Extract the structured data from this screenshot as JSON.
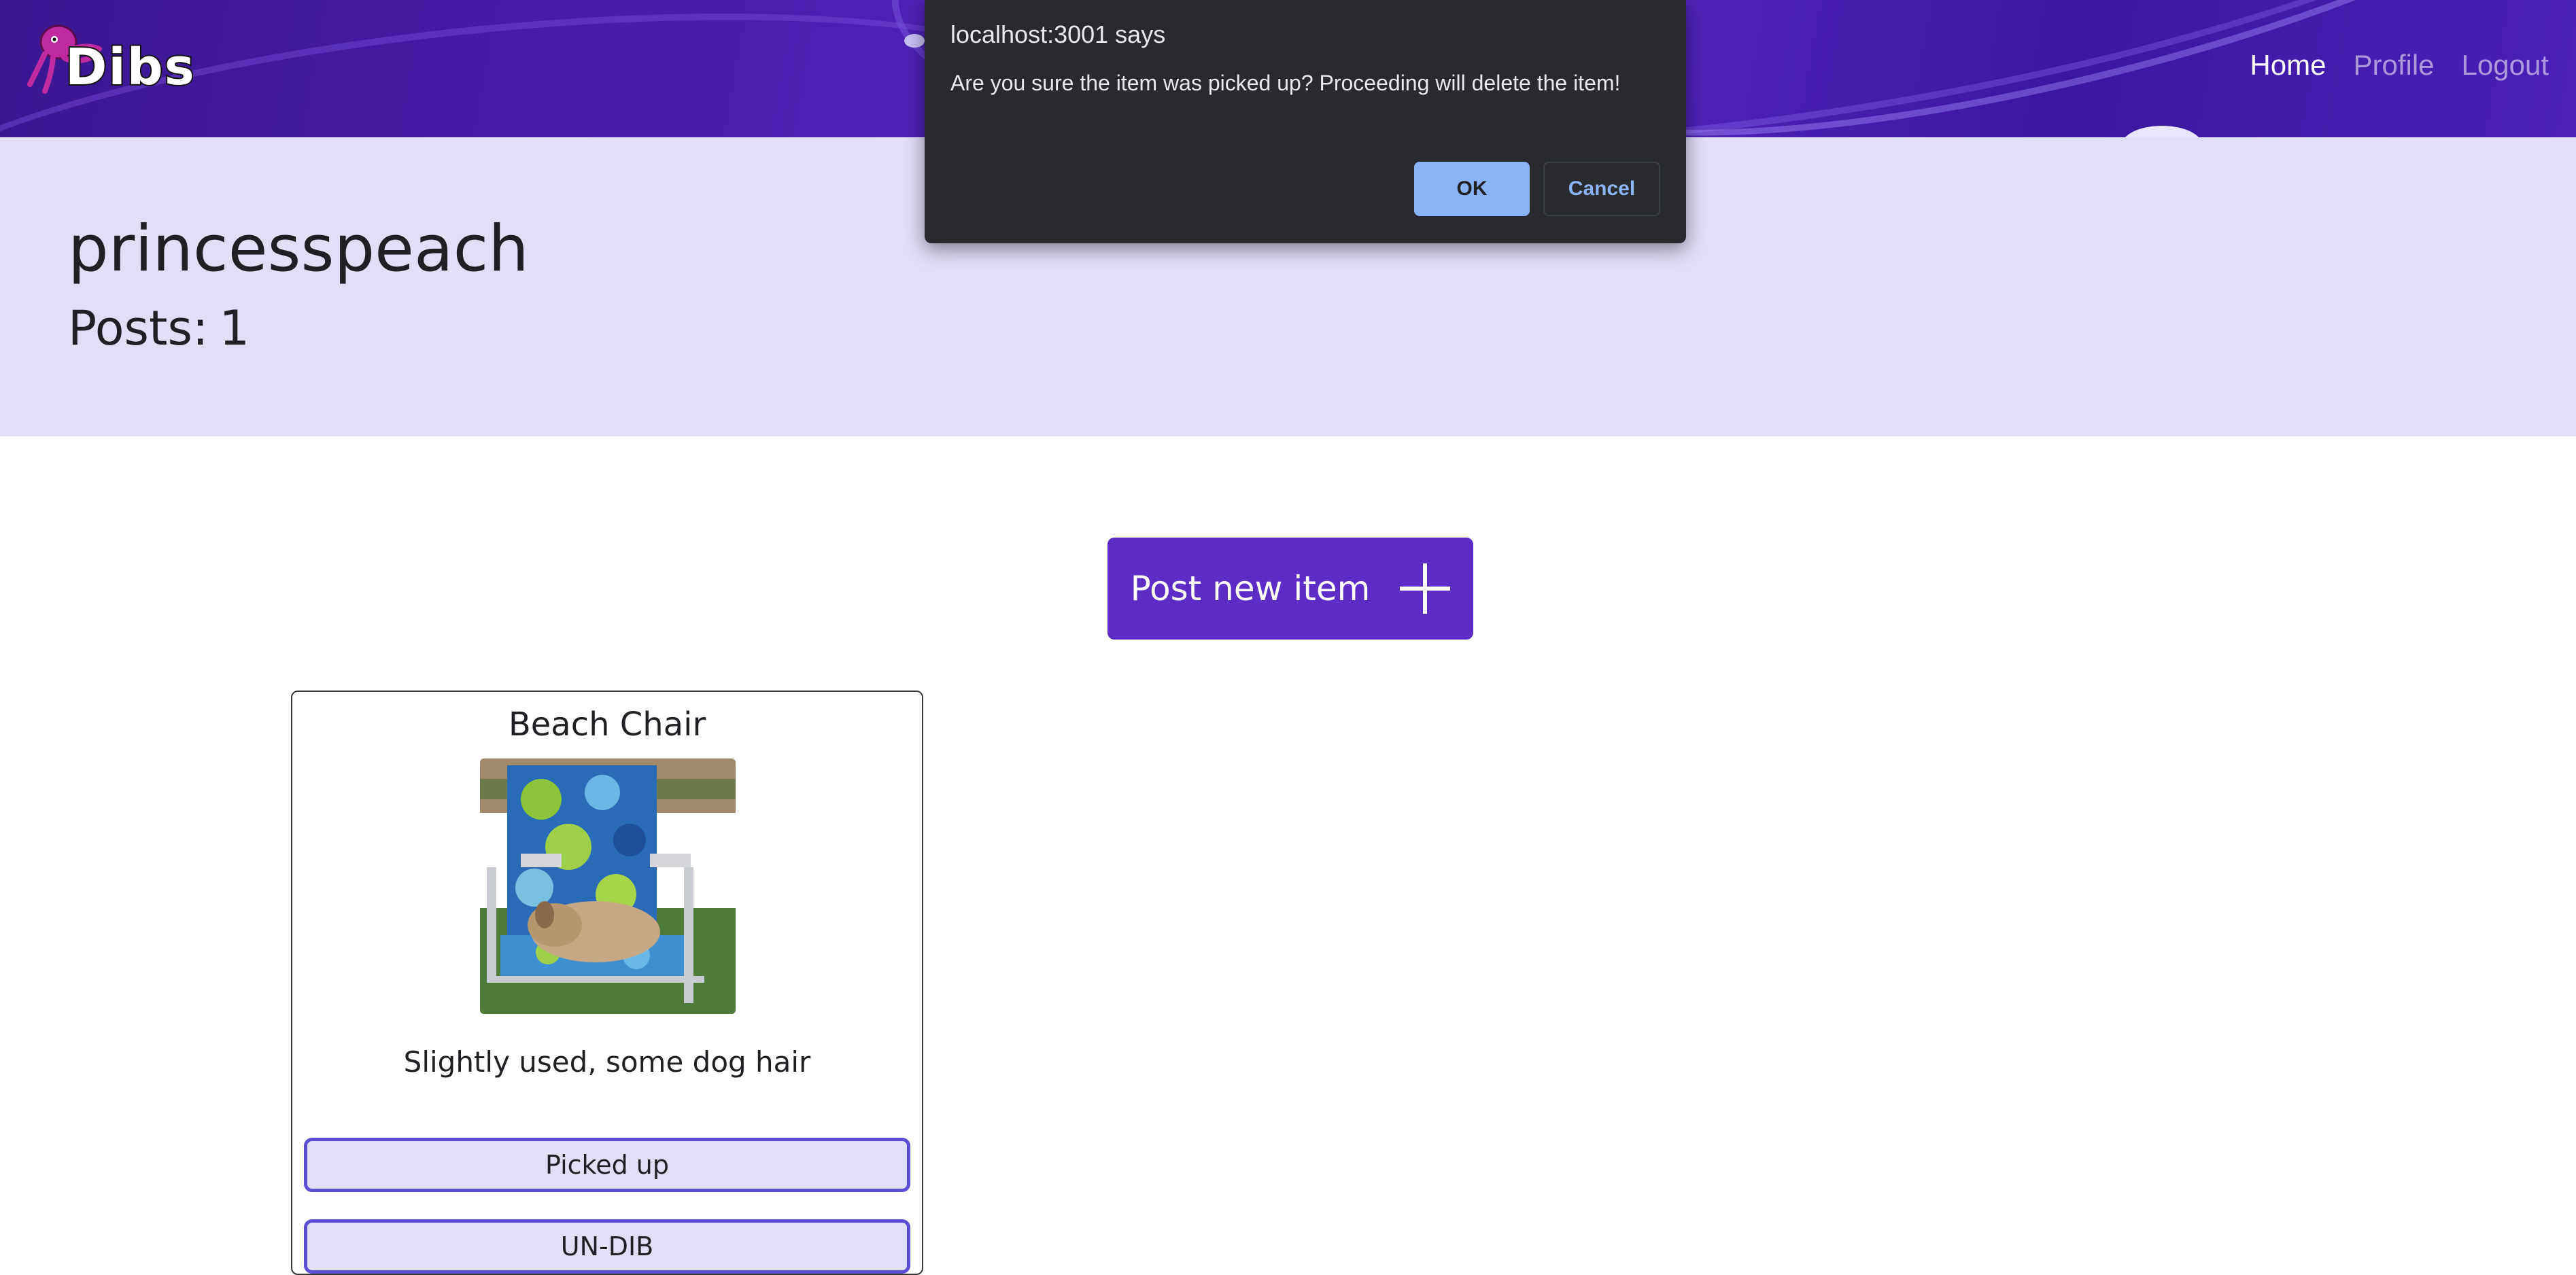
{
  "navbar": {
    "logo_text": "Dibs",
    "links": [
      {
        "label": "Home",
        "active": true
      },
      {
        "label": "Profile",
        "active": false
      },
      {
        "label": "Logout",
        "active": false
      }
    ]
  },
  "profile": {
    "username": "princesspeach",
    "posts_label": "Posts:",
    "posts_count": "1"
  },
  "actions": {
    "post_new_label": "Post new item"
  },
  "item": {
    "title": "Beach Chair",
    "image_icon": "photo-dog-on-beach-chair",
    "description": "Slightly used, some dog hair",
    "picked_up_label": "Picked up",
    "undib_label": "UN-DIB"
  },
  "dialog": {
    "title": "localhost:3001 says",
    "message": "Are you sure the item was picked up? Proceeding will delete the item!",
    "ok_label": "OK",
    "cancel_label": "Cancel"
  },
  "colors": {
    "navbar": "#4a1fb0",
    "banner": "#e1dff6",
    "primary_button": "#5b2dc6",
    "card_button_border": "#5b4dd6",
    "dialog_bg": "#292a2d",
    "dialog_accent": "#8ab4f8"
  }
}
